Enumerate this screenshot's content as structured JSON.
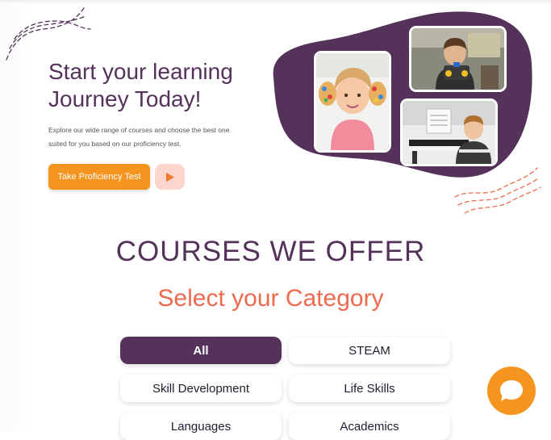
{
  "hero": {
    "title_line1": "Start your learning",
    "title_line2": "Journey Today!",
    "description": "Explore our wide range of courses and choose the best one suited for you based on our proficiency test.",
    "cta_label": "Take Proficiency Test",
    "play_icon": "play-icon"
  },
  "courses": {
    "title": "COURSES WE OFFER",
    "subtitle": "Select your Category",
    "categories": [
      {
        "label": "All",
        "active": true
      },
      {
        "label": "STEAM",
        "active": false
      },
      {
        "label": "Skill Development",
        "active": false
      },
      {
        "label": "Life Skills",
        "active": false
      },
      {
        "label": "Languages",
        "active": false
      },
      {
        "label": "Academics",
        "active": false
      }
    ]
  },
  "colors": {
    "brand_purple": "#54325a",
    "accent_orange": "#f5941f",
    "accent_coral": "#ee6a4f",
    "play_bg": "#fbd6cf"
  },
  "icons": {
    "chat": "chat-bubble-icon"
  }
}
